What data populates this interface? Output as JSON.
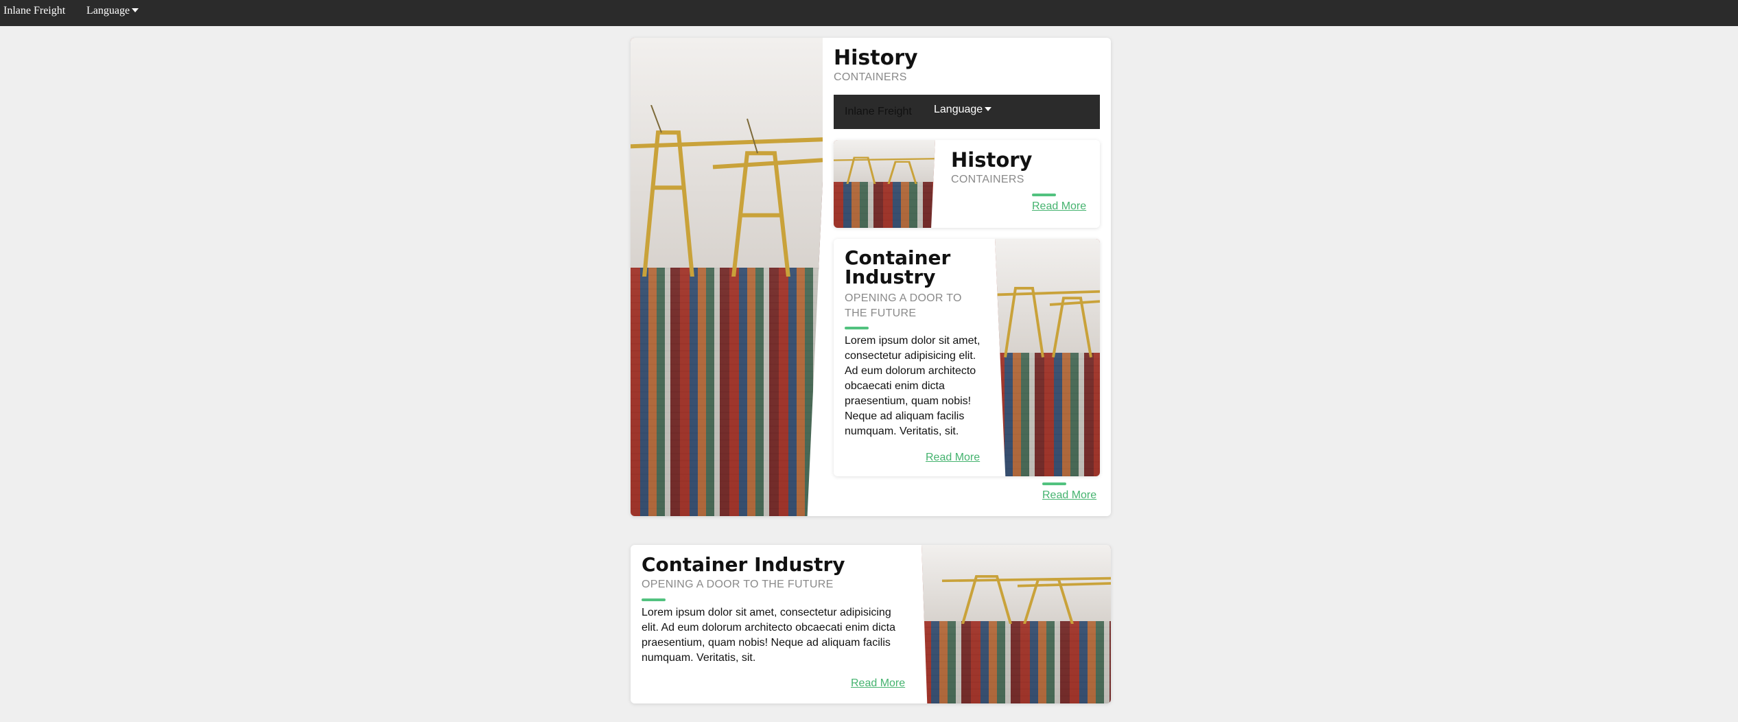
{
  "nav": {
    "brand": "Inlane Freight",
    "language": "Language"
  },
  "history_card": {
    "title": "History",
    "subtitle": "CONTAINERS",
    "inner_nav": {
      "brand": "Inlane Freight",
      "language": "Language"
    },
    "mini_card": {
      "title": "History",
      "subtitle": "CONTAINERS",
      "read_more": "Read More"
    },
    "industry_card": {
      "title": "Container Industry",
      "subtitle": "OPENING A DOOR TO THE FUTURE",
      "body": "Lorem ipsum dolor sit amet, consectetur adipisicing elit. Ad eum dolorum architecto obcaecati enim dicta praesentium, quam nobis! Neque ad aliquam facilis numquam. Veritatis, sit.",
      "read_more": "Read More"
    },
    "read_more": "Read More"
  },
  "industry_card": {
    "title": "Container Industry",
    "subtitle": "OPENING A DOOR TO THE FUTURE",
    "body": "Lorem ipsum dolor sit amet, consectetur adipisicing elit. Ad eum dolorum architecto obcaecati enim dicta praesentium, quam nobis! Neque ad aliquam facilis numquam. Veritatis, sit.",
    "read_more": "Read More"
  },
  "colors": {
    "accent": "#52c27f",
    "link": "#45b36f",
    "nav_bg": "#2b2b2b",
    "page_bg": "#efefef"
  }
}
